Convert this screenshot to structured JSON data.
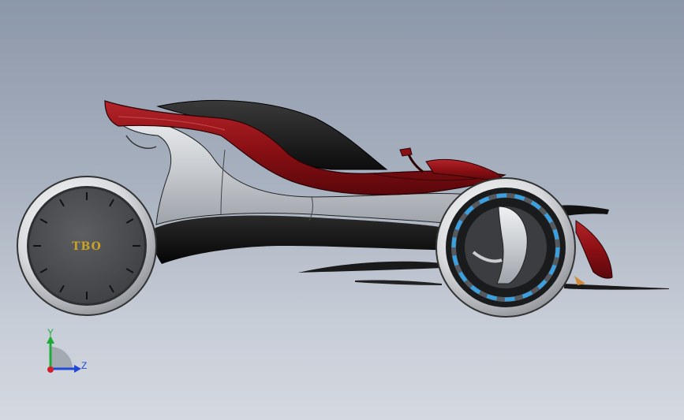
{
  "colors": {
    "background_top": "#8c97a9",
    "background_bottom": "#d4d9e0",
    "body_red": "#8b1014",
    "canopy_black": "#1a1a1a",
    "body_silver": "#c9ccd0",
    "wheel_blue_accent": "#3aa0e0",
    "hub_text_color": "#c9a227",
    "axis_y": "#1faa3a",
    "axis_z": "#1f49d6",
    "axis_x_origin": "#d0202a"
  },
  "viewport": {
    "front_wheel_hub_label": "TBO",
    "wheel_clock_marks": 12,
    "rear_wheel_blue_segments": 18
  },
  "triad": {
    "y_label": "Y",
    "z_label": "Z"
  }
}
